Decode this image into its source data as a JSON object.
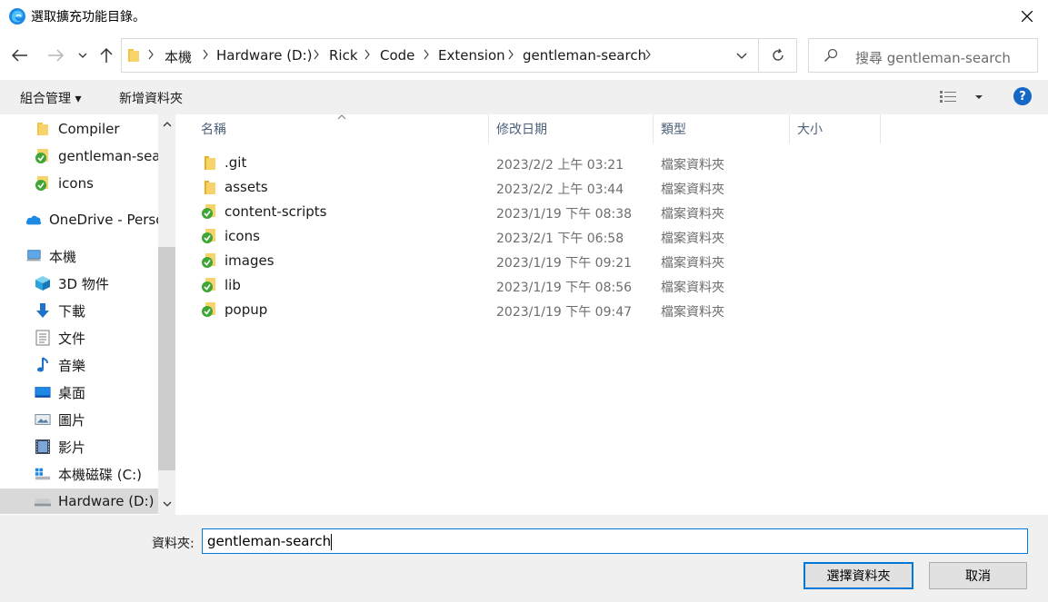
{
  "window": {
    "title": "選取擴充功能目錄。",
    "close_icon": "close-icon"
  },
  "address": {
    "crumbs": [
      "本機",
      "Hardware (D:)",
      "Rick",
      "Code",
      "Extension",
      "gentleman-search"
    ]
  },
  "search": {
    "placeholder": "搜尋 gentleman-search"
  },
  "commands": {
    "organize": "組合管理 ▾",
    "new_folder": "新增資料夾"
  },
  "nav_pane": {
    "items": [
      {
        "label": "Compiler",
        "icon": "folder-icon"
      },
      {
        "label": "gentleman-search",
        "icon": "synced-folder-icon"
      },
      {
        "label": "icons",
        "icon": "synced-folder-icon"
      },
      {
        "label": "OneDrive - Personal",
        "icon": "onedrive-icon"
      },
      {
        "label": "本機",
        "icon": "computer-icon"
      },
      {
        "label": "3D 物件",
        "icon": "3d-objects-icon"
      },
      {
        "label": "下載",
        "icon": "download-icon"
      },
      {
        "label": "文件",
        "icon": "documents-icon"
      },
      {
        "label": "音樂",
        "icon": "music-icon"
      },
      {
        "label": "桌面",
        "icon": "desktop-icon"
      },
      {
        "label": "圖片",
        "icon": "pictures-icon"
      },
      {
        "label": "影片",
        "icon": "videos-icon"
      },
      {
        "label": "本機磁碟 (C:)",
        "icon": "drive-c-icon"
      },
      {
        "label": "Hardware (D:)",
        "icon": "drive-icon"
      }
    ]
  },
  "columns": {
    "name": "名稱",
    "modified": "修改日期",
    "type": "類型",
    "size": "大小"
  },
  "files": [
    {
      "name": ".git",
      "modified": "2023/2/2 上午 03:21",
      "type": "檔案資料夾",
      "icon": "folder-icon"
    },
    {
      "name": "assets",
      "modified": "2023/2/2 上午 03:44",
      "type": "檔案資料夾",
      "icon": "folder-icon"
    },
    {
      "name": "content-scripts",
      "modified": "2023/1/19 下午 08:38",
      "type": "檔案資料夾",
      "icon": "synced-folder-icon"
    },
    {
      "name": "icons",
      "modified": "2023/2/1 下午 06:58",
      "type": "檔案資料夾",
      "icon": "synced-folder-icon"
    },
    {
      "name": "images",
      "modified": "2023/1/19 下午 09:21",
      "type": "檔案資料夾",
      "icon": "synced-folder-icon"
    },
    {
      "name": "lib",
      "modified": "2023/1/19 下午 08:56",
      "type": "檔案資料夾",
      "icon": "synced-folder-icon"
    },
    {
      "name": "popup",
      "modified": "2023/1/19 下午 09:47",
      "type": "檔案資料夾",
      "icon": "synced-folder-icon"
    }
  ],
  "bottom": {
    "folder_label": "資料夾:",
    "folder_value": "gentleman-search",
    "select_button": "選擇資料夾",
    "cancel_button": "取消"
  },
  "colors": {
    "accent": "#0078d7",
    "sync_green": "#3fa535",
    "folder_yellow": "#f4c542"
  }
}
